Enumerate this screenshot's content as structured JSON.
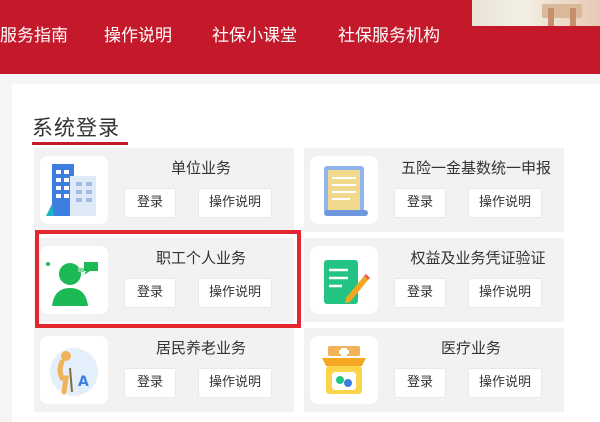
{
  "nav": {
    "items": [
      "服务指南",
      "操作说明",
      "社保小课堂",
      "社保服务机构"
    ]
  },
  "section": {
    "title": "系统登录"
  },
  "cards": [
    {
      "name": "单位业务",
      "login": "登录",
      "guide": "操作说明",
      "icon": "building-icon"
    },
    {
      "name": "五险一金基数统一申报",
      "login": "登录",
      "guide": "操作说明",
      "icon": "document-scroll-icon"
    },
    {
      "name": "职工个人业务",
      "login": "登录",
      "guide": "操作说明",
      "icon": "person-chat-icon"
    },
    {
      "name": "权益及业务凭证验证",
      "login": "登录",
      "guide": "操作说明",
      "icon": "form-pen-icon"
    },
    {
      "name": "居民养老业务",
      "login": "登录",
      "guide": "操作说明",
      "icon": "elderly-icon"
    },
    {
      "name": "医疗业务",
      "login": "登录",
      "guide": "操作说明",
      "icon": "medical-shop-icon"
    }
  ],
  "colors": {
    "brand_red": "#c4182b",
    "highlight_red": "#e4262e",
    "card_bg": "#f2f2f2"
  }
}
